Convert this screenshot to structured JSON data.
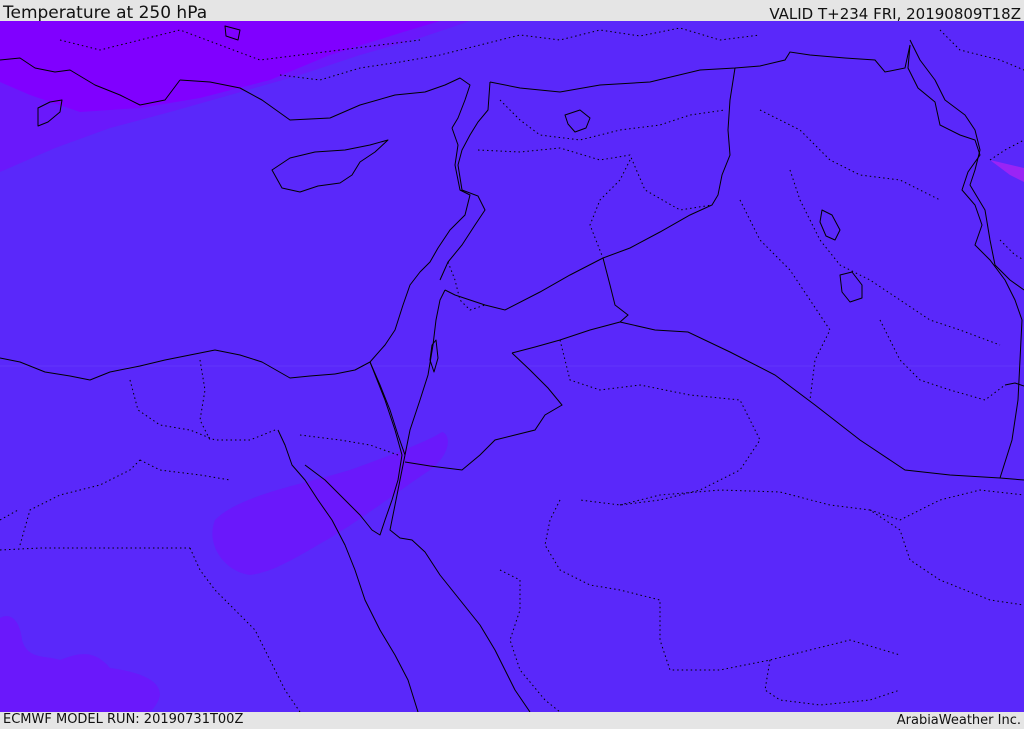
{
  "header": {
    "title": "Temperature at 250 hPa",
    "valid_time": "VALID T+234 FRI, 20190809T18Z"
  },
  "footer": {
    "model_run": "ECMWF MODEL RUN: 20190731T00Z",
    "credit": "ArabiaWeather Inc."
  },
  "map": {
    "region": "Eastern Mediterranean and Middle East",
    "field_colors": {
      "base": "#5a28fa",
      "cooler_band": "#6a18fb",
      "coldest": "#8000ff",
      "pink_edge": "#a020f0"
    },
    "coastline_color": "#000000",
    "border_style": "dotted"
  }
}
